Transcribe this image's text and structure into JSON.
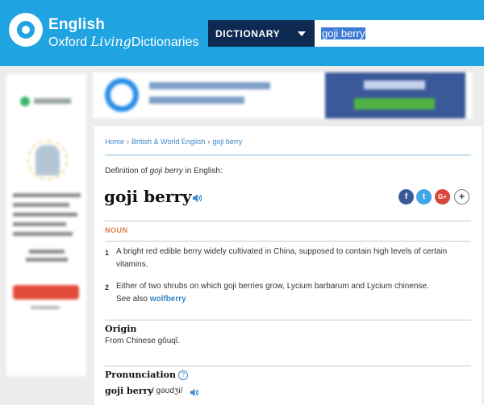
{
  "header": {
    "brand_line1": "English",
    "brand_line2_a": "Oxford",
    "brand_line2_b": "Living",
    "brand_line2_c": "Dictionaries",
    "dictionary_select": "DICTIONARY",
    "search_value": "goji berry"
  },
  "breadcrumb": {
    "home": "Home",
    "section": "British & World English",
    "current": "goji berry",
    "separator": "›"
  },
  "entry": {
    "definition_prefix": "Definition of",
    "definition_term": "goji berry",
    "definition_suffix": "in English:",
    "headword": "goji berry",
    "part_of_speech": "NOUN",
    "senses": [
      {
        "number": "1",
        "text": "A bright red edible berry widely cultivated in China, supposed to contain high levels of certain vitamins."
      },
      {
        "number": "2",
        "text": "Either of two shrubs on which goji berries grow, Lycium barbarum and Lycium chinense.",
        "see_also_label": "See also",
        "see_also_link": "wolfberry"
      }
    ],
    "origin_heading": "Origin",
    "origin_text": "From Chinese gǒuqǐ.",
    "pronunciation_heading": "Pronunciation",
    "pronunciation_word": "goji berry",
    "pronunciation_ipa": "/ ɡəʊdʒi/"
  },
  "social": {
    "facebook": "f",
    "twitter": "t",
    "google_plus": "G+",
    "more": "+"
  },
  "help_icon": "?",
  "colors": {
    "header_bg": "#1fa3e1",
    "select_bg": "#0f2a52",
    "link": "#3a87c9",
    "pos": "#e07b4a"
  }
}
